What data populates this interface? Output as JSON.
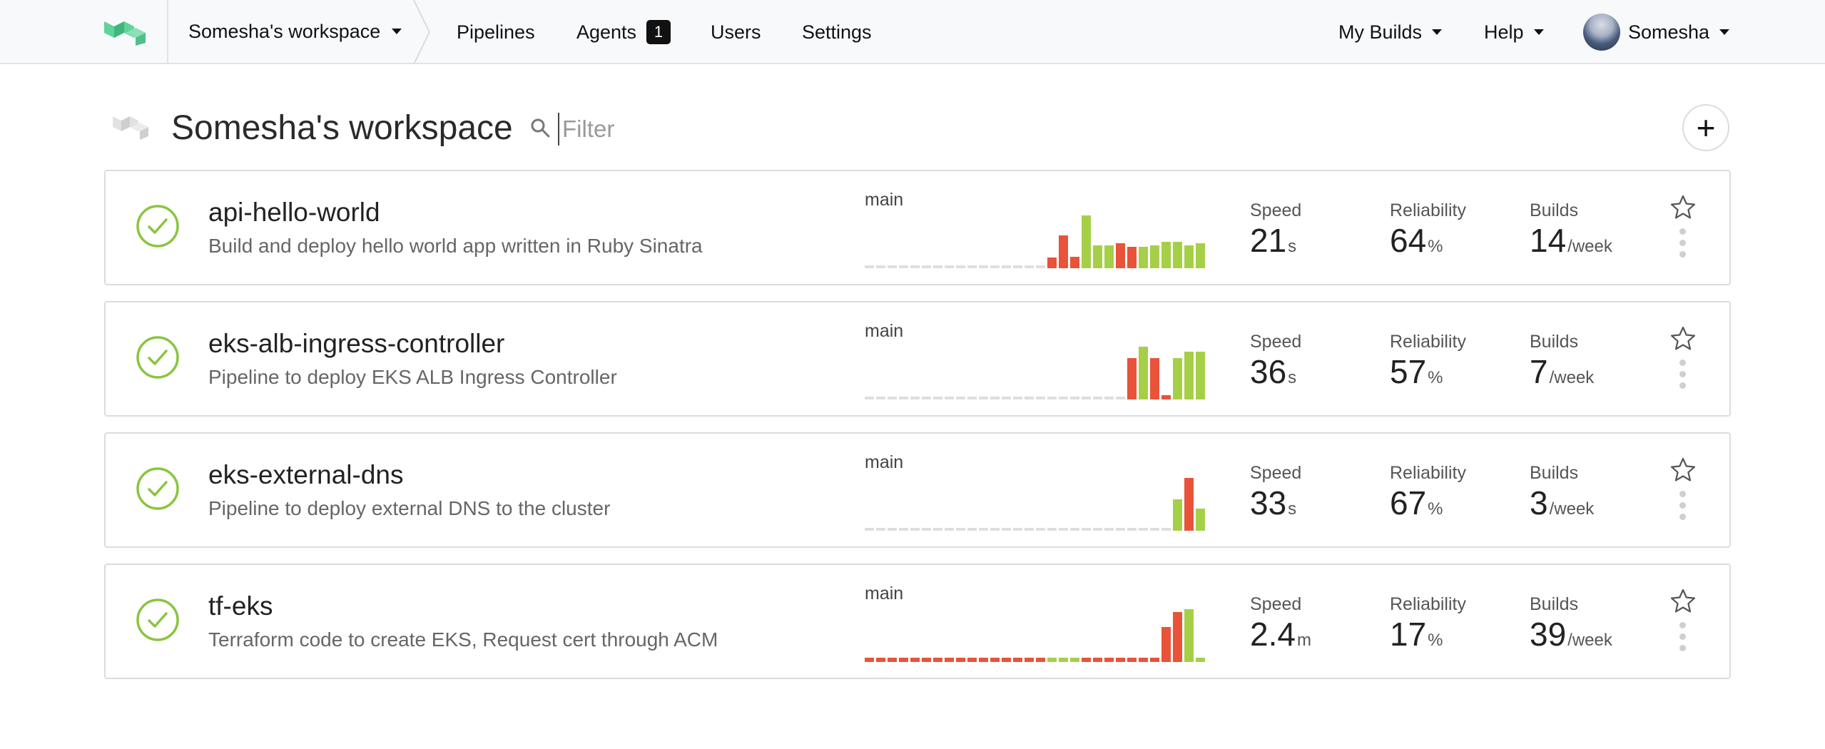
{
  "topnav": {
    "workspace_label": "Somesha's workspace",
    "links": {
      "pipelines": "Pipelines",
      "agents": "Agents",
      "users": "Users",
      "settings": "Settings"
    },
    "agents_count": "1",
    "my_builds": "My Builds",
    "help": "Help",
    "user": "Somesha"
  },
  "header": {
    "title": "Somesha's workspace",
    "filter_placeholder": "Filter",
    "add_label": "+"
  },
  "colors": {
    "passed": "#a6cf48",
    "failed": "#e8533a",
    "empty": "#dedede",
    "status_ok": "#8ac53f"
  },
  "pipelines": [
    {
      "name": "api-hello-world",
      "description": "Build and deploy hello world app written in Ruby Sinatra",
      "branch": "main",
      "speed": {
        "label": "Speed",
        "value": "21",
        "unit": "s"
      },
      "reliability": {
        "label": "Reliability",
        "value": "64",
        "unit": "%"
      },
      "builds": {
        "label": "Builds",
        "value": "14",
        "unit": "/week"
      },
      "history": [
        {
          "s": "empty",
          "h": 0
        },
        {
          "s": "empty",
          "h": 0
        },
        {
          "s": "empty",
          "h": 0
        },
        {
          "s": "empty",
          "h": 0
        },
        {
          "s": "empty",
          "h": 0
        },
        {
          "s": "empty",
          "h": 0
        },
        {
          "s": "empty",
          "h": 0
        },
        {
          "s": "empty",
          "h": 0
        },
        {
          "s": "empty",
          "h": 0
        },
        {
          "s": "empty",
          "h": 0
        },
        {
          "s": "empty",
          "h": 0
        },
        {
          "s": "empty",
          "h": 0
        },
        {
          "s": "empty",
          "h": 0
        },
        {
          "s": "empty",
          "h": 0
        },
        {
          "s": "empty",
          "h": 0
        },
        {
          "s": "empty",
          "h": 0
        },
        {
          "s": "failed",
          "h": 0.2
        },
        {
          "s": "failed",
          "h": 0.62
        },
        {
          "s": "failed",
          "h": 0.22
        },
        {
          "s": "passed",
          "h": 1.0
        },
        {
          "s": "passed",
          "h": 0.43
        },
        {
          "s": "passed",
          "h": 0.43
        },
        {
          "s": "failed",
          "h": 0.47
        },
        {
          "s": "failed",
          "h": 0.4
        },
        {
          "s": "passed",
          "h": 0.4
        },
        {
          "s": "passed",
          "h": 0.43
        },
        {
          "s": "passed",
          "h": 0.5
        },
        {
          "s": "passed",
          "h": 0.5
        },
        {
          "s": "passed",
          "h": 0.43
        },
        {
          "s": "passed",
          "h": 0.47
        }
      ]
    },
    {
      "name": "eks-alb-ingress-controller",
      "description": "Pipeline to deploy EKS ALB Ingress Controller",
      "branch": "main",
      "speed": {
        "label": "Speed",
        "value": "36",
        "unit": "s"
      },
      "reliability": {
        "label": "Reliability",
        "value": "57",
        "unit": "%"
      },
      "builds": {
        "label": "Builds",
        "value": "7",
        "unit": "/week"
      },
      "history": [
        {
          "s": "empty",
          "h": 0
        },
        {
          "s": "empty",
          "h": 0
        },
        {
          "s": "empty",
          "h": 0
        },
        {
          "s": "empty",
          "h": 0
        },
        {
          "s": "empty",
          "h": 0
        },
        {
          "s": "empty",
          "h": 0
        },
        {
          "s": "empty",
          "h": 0
        },
        {
          "s": "empty",
          "h": 0
        },
        {
          "s": "empty",
          "h": 0
        },
        {
          "s": "empty",
          "h": 0
        },
        {
          "s": "empty",
          "h": 0
        },
        {
          "s": "empty",
          "h": 0
        },
        {
          "s": "empty",
          "h": 0
        },
        {
          "s": "empty",
          "h": 0
        },
        {
          "s": "empty",
          "h": 0
        },
        {
          "s": "empty",
          "h": 0
        },
        {
          "s": "empty",
          "h": 0
        },
        {
          "s": "empty",
          "h": 0
        },
        {
          "s": "empty",
          "h": 0
        },
        {
          "s": "empty",
          "h": 0
        },
        {
          "s": "empty",
          "h": 0
        },
        {
          "s": "empty",
          "h": 0
        },
        {
          "s": "empty",
          "h": 0
        },
        {
          "s": "failed",
          "h": 0.78
        },
        {
          "s": "passed",
          "h": 1.0
        },
        {
          "s": "failed",
          "h": 0.78
        },
        {
          "s": "failed",
          "h": 0.08
        },
        {
          "s": "passed",
          "h": 0.78
        },
        {
          "s": "passed",
          "h": 0.9
        },
        {
          "s": "passed",
          "h": 0.9
        }
      ]
    },
    {
      "name": "eks-external-dns",
      "description": "Pipeline to deploy external DNS to the cluster",
      "branch": "main",
      "speed": {
        "label": "Speed",
        "value": "33",
        "unit": "s"
      },
      "reliability": {
        "label": "Reliability",
        "value": "67",
        "unit": "%"
      },
      "builds": {
        "label": "Builds",
        "value": "3",
        "unit": "/week"
      },
      "history": [
        {
          "s": "empty",
          "h": 0
        },
        {
          "s": "empty",
          "h": 0
        },
        {
          "s": "empty",
          "h": 0
        },
        {
          "s": "empty",
          "h": 0
        },
        {
          "s": "empty",
          "h": 0
        },
        {
          "s": "empty",
          "h": 0
        },
        {
          "s": "empty",
          "h": 0
        },
        {
          "s": "empty",
          "h": 0
        },
        {
          "s": "empty",
          "h": 0
        },
        {
          "s": "empty",
          "h": 0
        },
        {
          "s": "empty",
          "h": 0
        },
        {
          "s": "empty",
          "h": 0
        },
        {
          "s": "empty",
          "h": 0
        },
        {
          "s": "empty",
          "h": 0
        },
        {
          "s": "empty",
          "h": 0
        },
        {
          "s": "empty",
          "h": 0
        },
        {
          "s": "empty",
          "h": 0
        },
        {
          "s": "empty",
          "h": 0
        },
        {
          "s": "empty",
          "h": 0
        },
        {
          "s": "empty",
          "h": 0
        },
        {
          "s": "empty",
          "h": 0
        },
        {
          "s": "empty",
          "h": 0
        },
        {
          "s": "empty",
          "h": 0
        },
        {
          "s": "empty",
          "h": 0
        },
        {
          "s": "empty",
          "h": 0
        },
        {
          "s": "empty",
          "h": 0
        },
        {
          "s": "empty",
          "h": 0
        },
        {
          "s": "passed",
          "h": 0.6
        },
        {
          "s": "failed",
          "h": 1.0
        },
        {
          "s": "passed",
          "h": 0.42
        }
      ]
    },
    {
      "name": "tf-eks",
      "description": "Terraform code to create EKS, Request cert through ACM",
      "branch": "main",
      "speed": {
        "label": "Speed",
        "value": "2.4",
        "unit": "m"
      },
      "reliability": {
        "label": "Reliability",
        "value": "17",
        "unit": "%"
      },
      "builds": {
        "label": "Builds",
        "value": "39",
        "unit": "/week"
      },
      "history": [
        {
          "s": "failed",
          "h": 0.08
        },
        {
          "s": "failed",
          "h": 0.08
        },
        {
          "s": "failed",
          "h": 0.08
        },
        {
          "s": "failed",
          "h": 0.08
        },
        {
          "s": "failed",
          "h": 0.08
        },
        {
          "s": "failed",
          "h": 0.08
        },
        {
          "s": "failed",
          "h": 0.08
        },
        {
          "s": "failed",
          "h": 0.08
        },
        {
          "s": "failed",
          "h": 0.08
        },
        {
          "s": "failed",
          "h": 0.08
        },
        {
          "s": "failed",
          "h": 0.08
        },
        {
          "s": "failed",
          "h": 0.08
        },
        {
          "s": "failed",
          "h": 0.08
        },
        {
          "s": "failed",
          "h": 0.08
        },
        {
          "s": "failed",
          "h": 0.08
        },
        {
          "s": "failed",
          "h": 0.08
        },
        {
          "s": "passed",
          "h": 0.08
        },
        {
          "s": "passed",
          "h": 0.08
        },
        {
          "s": "passed",
          "h": 0.08
        },
        {
          "s": "failed",
          "h": 0.08
        },
        {
          "s": "failed",
          "h": 0.08
        },
        {
          "s": "failed",
          "h": 0.08
        },
        {
          "s": "failed",
          "h": 0.08
        },
        {
          "s": "failed",
          "h": 0.08
        },
        {
          "s": "failed",
          "h": 0.08
        },
        {
          "s": "failed",
          "h": 0.08
        },
        {
          "s": "failed",
          "h": 0.66
        },
        {
          "s": "failed",
          "h": 0.94
        },
        {
          "s": "passed",
          "h": 1.0
        },
        {
          "s": "passed",
          "h": 0.08
        }
      ]
    }
  ]
}
